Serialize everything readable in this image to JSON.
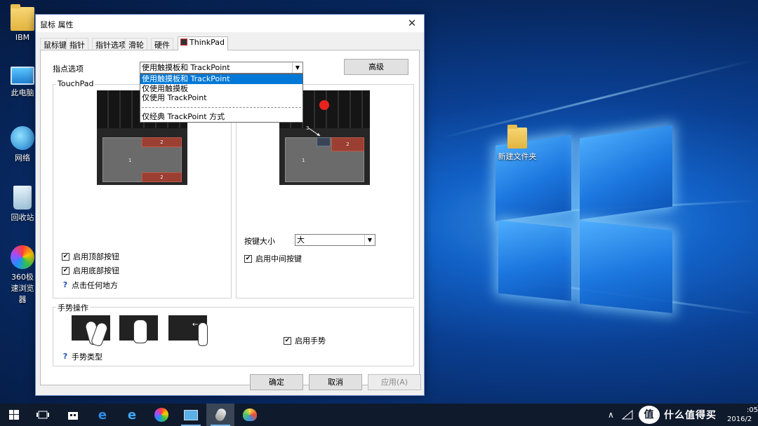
{
  "desktop": {
    "icons": [
      {
        "label": "IBM"
      },
      {
        "label": "此电脑"
      },
      {
        "label": "网络"
      },
      {
        "label": "回收站"
      },
      {
        "label": "360极速浏览器"
      },
      {
        "label": "新建文件夹"
      }
    ]
  },
  "dialog": {
    "title": "鼠标 属性",
    "close_glyph": "✕",
    "tabs": [
      "鼠标键",
      "指针",
      "指针选项",
      "滑轮",
      "硬件",
      "ThinkPad"
    ],
    "active_tab": "ThinkPad",
    "pointing_label": "指点选项",
    "pointing_value": "使用触摸板和 TrackPoint",
    "dropdown_options": [
      "使用触摸板和 TrackPoint",
      "仅使用触摸板",
      "仅使用 TrackPoint",
      "仅经典 TrackPoint 方式"
    ],
    "advanced_button": "高级",
    "touchpad_group": "TouchPad",
    "zone_labels": {
      "one": "1",
      "two": "2",
      "three": "3"
    },
    "touchpad_checks": [
      {
        "label": "启用顶部按钮",
        "checked": true
      },
      {
        "label": "启用底部按钮",
        "checked": true
      }
    ],
    "tap_anywhere": "点击任何地方",
    "button_size_label": "按键大小",
    "button_size_value": "大",
    "middle_button": {
      "label": "启用中间按键",
      "checked": true
    },
    "gesture_group": "手势操作",
    "enable_gestures": {
      "label": "启用手势",
      "checked": true
    },
    "gesture_types": "手势类型",
    "check_glyph": "✔",
    "help_glyph": "?",
    "combo_arrow": "▼",
    "ok": "确定",
    "cancel": "取消",
    "apply": "应用(A)"
  },
  "taskbar": {
    "items": [
      "start-icon",
      "task-view-icon",
      "store-icon",
      "edge-icon",
      "ie-icon",
      "360-browser-icon",
      "control-panel-icon",
      "mouse-icon",
      "paint-icon"
    ],
    "clock_time": ":05",
    "clock_date": "2016/2",
    "tray_chevron": "∧",
    "watermark": "值 什么值得买"
  }
}
